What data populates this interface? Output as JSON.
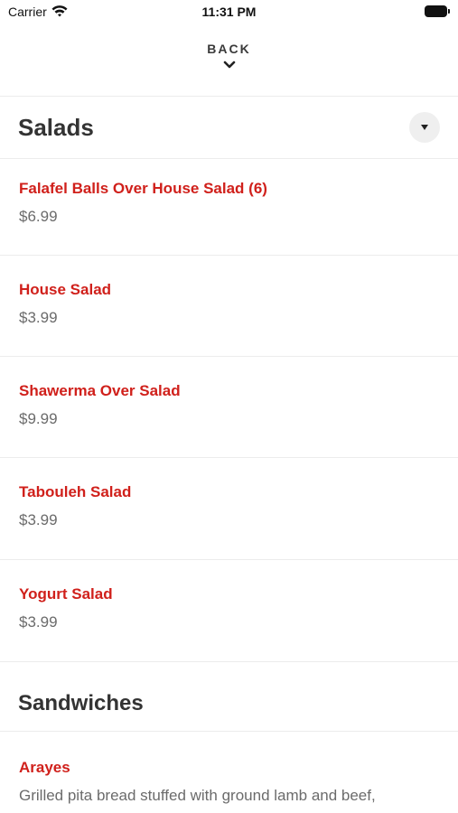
{
  "status_bar": {
    "carrier": "Carrier",
    "time": "11:31 PM"
  },
  "nav": {
    "back_label": "BACK"
  },
  "sections": [
    {
      "title": "Salads",
      "items": [
        {
          "name": "Falafel Balls Over House Salad (6)",
          "price": "$6.99"
        },
        {
          "name": "House Salad",
          "price": "$3.99"
        },
        {
          "name": "Shawerma Over Salad",
          "price": "$9.99"
        },
        {
          "name": "Tabouleh Salad",
          "price": "$3.99"
        },
        {
          "name": "Yogurt Salad",
          "price": "$3.99"
        }
      ]
    },
    {
      "title": "Sandwiches",
      "items": [
        {
          "name": "Arayes",
          "description": "Grilled pita bread stuffed with ground lamb and beef,"
        }
      ]
    }
  ],
  "colors": {
    "item_name": "#d0201b",
    "price": "#6b6b6b",
    "divider": "#ececec"
  },
  "icons": {
    "wifi": "wifi-icon",
    "battery": "battery-icon",
    "back": "chevron-down-icon",
    "collapse": "caret-down-icon"
  }
}
